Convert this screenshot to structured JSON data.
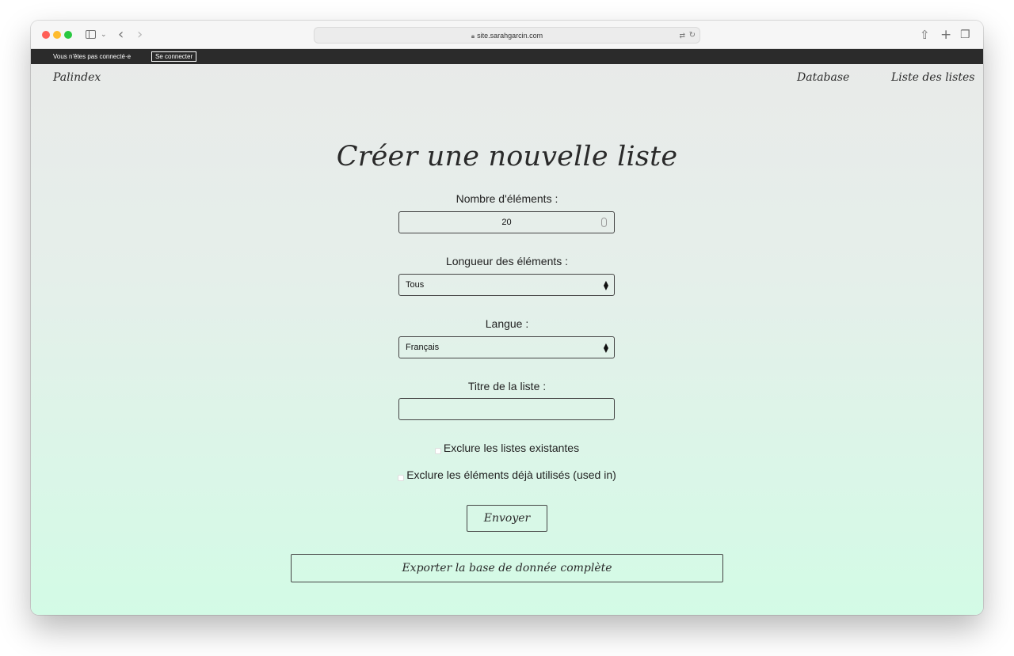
{
  "browser": {
    "url": "site.sarahgarcin.com",
    "icons": {
      "sidebar": "sidebar-icon",
      "back": "chevron-left-icon",
      "forward": "chevron-right-icon",
      "lock": "lock-icon",
      "translate": "translate-icon",
      "reload": "reload-icon",
      "share": "share-icon",
      "new_tab": "plus-icon",
      "tabs": "tab-overview-icon"
    }
  },
  "admin_bar": {
    "status": "Vous n'êtes pas connecté·e",
    "login_label": "Se connecter"
  },
  "header": {
    "brand": "Palindex",
    "nav": {
      "database": "Database",
      "lists": "Liste des listes"
    }
  },
  "form": {
    "title": "Créer une nouvelle liste",
    "count_label": "Nombre d'éléments :",
    "count_value": "20",
    "length_label": "Longueur des éléments :",
    "length_value": "Tous",
    "language_label": "Langue :",
    "language_value": "Français",
    "list_title_label": "Titre de la liste :",
    "list_title_value": "",
    "exclude_existing_label": "Exclure les listes existantes",
    "exclude_existing_checked": false,
    "exclude_used_label": "Exclure les éléments déjà utilisés (used in)",
    "exclude_used_checked": false,
    "submit_label": "Envoyer",
    "export_label": "Exporter la base de donnée complète"
  },
  "colors": {
    "gradient_top": "#e9eae9",
    "gradient_bottom": "#d3fbe6",
    "admin_bar": "#2b2b2b",
    "text": "#2a2a2a"
  }
}
